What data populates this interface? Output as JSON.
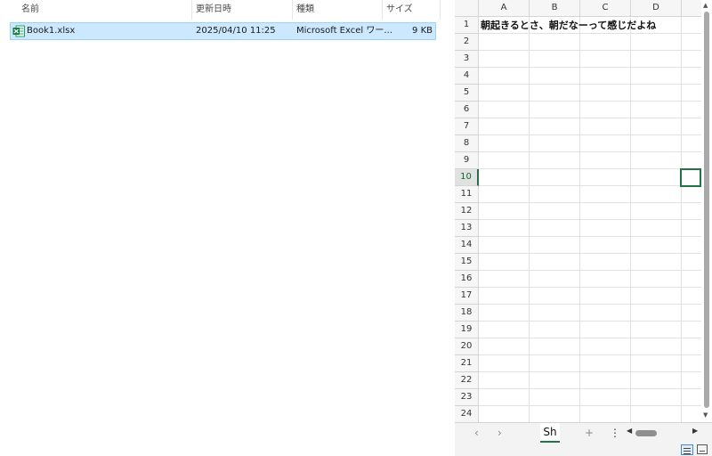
{
  "explorer": {
    "columns": {
      "name": "名前",
      "date": "更新日時",
      "type": "種類",
      "size": "サイズ"
    },
    "file": {
      "name": "Book1.xlsx",
      "date": "2025/04/10 11:25",
      "type": "Microsoft Excel ワー...",
      "size": "9 KB",
      "icon": "excel-file-icon"
    }
  },
  "excel": {
    "columns": [
      "A",
      "B",
      "C",
      "D"
    ],
    "rows": [
      "1",
      "2",
      "3",
      "4",
      "5",
      "6",
      "7",
      "8",
      "9",
      "10",
      "11",
      "12",
      "13",
      "14",
      "15",
      "16",
      "17",
      "18",
      "19",
      "20",
      "21",
      "22",
      "23",
      "24"
    ],
    "active_row": "10",
    "cell_a1": "朝起きるとさ、朝だなーって感じだよね",
    "sheet_tab": "Sh",
    "tabbar": {
      "prev": "‹",
      "next": "›",
      "add": "+",
      "more": "⋮"
    },
    "accent_color": "#217346"
  }
}
